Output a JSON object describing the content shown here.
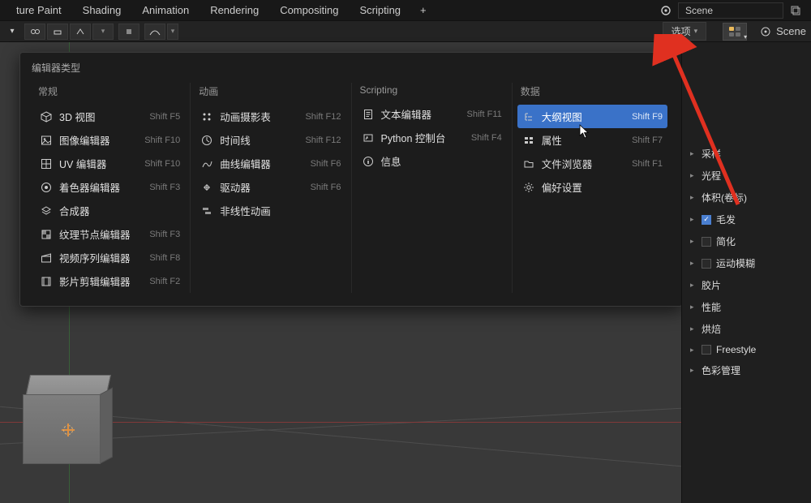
{
  "topbar": {
    "tabs": [
      "ture Paint",
      "Shading",
      "Animation",
      "Rendering",
      "Compositing",
      "Scripting"
    ],
    "scene_field": "Scene"
  },
  "toolbar2": {
    "options_label": "选项",
    "outliner_label": "Scene"
  },
  "popup": {
    "title": "编辑器类型",
    "columns": [
      {
        "head": "常规",
        "items": [
          {
            "icon": "cube-icon",
            "label": "3D 视图",
            "shortcut": "Shift F5"
          },
          {
            "icon": "image-icon",
            "label": "图像编辑器",
            "shortcut": "Shift F10"
          },
          {
            "icon": "uv-icon",
            "label": "UV 编辑器",
            "shortcut": "Shift F10"
          },
          {
            "icon": "palette-icon",
            "label": "着色器编辑器",
            "shortcut": "Shift F3"
          },
          {
            "icon": "layers-icon",
            "label": "合成器",
            "shortcut": ""
          },
          {
            "icon": "texture-icon",
            "label": "纹理节点编辑器",
            "shortcut": "Shift F3"
          },
          {
            "icon": "clapper-icon",
            "label": "视频序列编辑器",
            "shortcut": "Shift F8"
          },
          {
            "icon": "film-icon",
            "label": "影片剪辑编辑器",
            "shortcut": "Shift F2"
          }
        ]
      },
      {
        "head": "动画",
        "items": [
          {
            "icon": "dopesheet-icon",
            "label": "动画摄影表",
            "shortcut": "Shift F12"
          },
          {
            "icon": "clock-icon",
            "label": "时间线",
            "shortcut": "Shift F12"
          },
          {
            "icon": "graph-icon",
            "label": "曲线编辑器",
            "shortcut": "Shift F6"
          },
          {
            "icon": "driver-icon",
            "label": "驱动器",
            "shortcut": "Shift F6"
          },
          {
            "icon": "nla-icon",
            "label": "非线性动画",
            "shortcut": ""
          }
        ]
      },
      {
        "head": "Scripting",
        "items": [
          {
            "icon": "text-icon",
            "label": "文本编辑器",
            "shortcut": "Shift F11"
          },
          {
            "icon": "python-icon",
            "label": "Python 控制台",
            "shortcut": "Shift F4"
          },
          {
            "icon": "info-icon",
            "label": "信息",
            "shortcut": ""
          }
        ]
      },
      {
        "head": "数据",
        "items": [
          {
            "icon": "outliner-icon",
            "label": "大纲视图",
            "shortcut": "Shift F9",
            "selected": true
          },
          {
            "icon": "props-icon",
            "label": "属性",
            "shortcut": "Shift F7"
          },
          {
            "icon": "folder-icon",
            "label": "文件浏览器",
            "shortcut": "Shift F1"
          },
          {
            "icon": "gear-icon",
            "label": "偏好设置",
            "shortcut": ""
          }
        ]
      }
    ]
  },
  "sidepanel": {
    "items": [
      {
        "label": "采样",
        "expandable": true
      },
      {
        "label": "光程",
        "expandable": true
      },
      {
        "label": "体积(卷标)",
        "expandable": true
      },
      {
        "label": "毛发",
        "expandable": true,
        "checked": true
      },
      {
        "label": "简化",
        "expandable": true,
        "checkbox_empty": true
      },
      {
        "label": "运动模糊",
        "expandable": true,
        "checkbox_empty": true
      },
      {
        "label": "胶片",
        "expandable": true
      },
      {
        "label": "性能",
        "expandable": true
      },
      {
        "label": "烘焙",
        "expandable": true
      },
      {
        "label": "Freestyle",
        "expandable": true,
        "checkbox_empty": true
      },
      {
        "label": "色彩管理",
        "expandable": true
      }
    ]
  }
}
